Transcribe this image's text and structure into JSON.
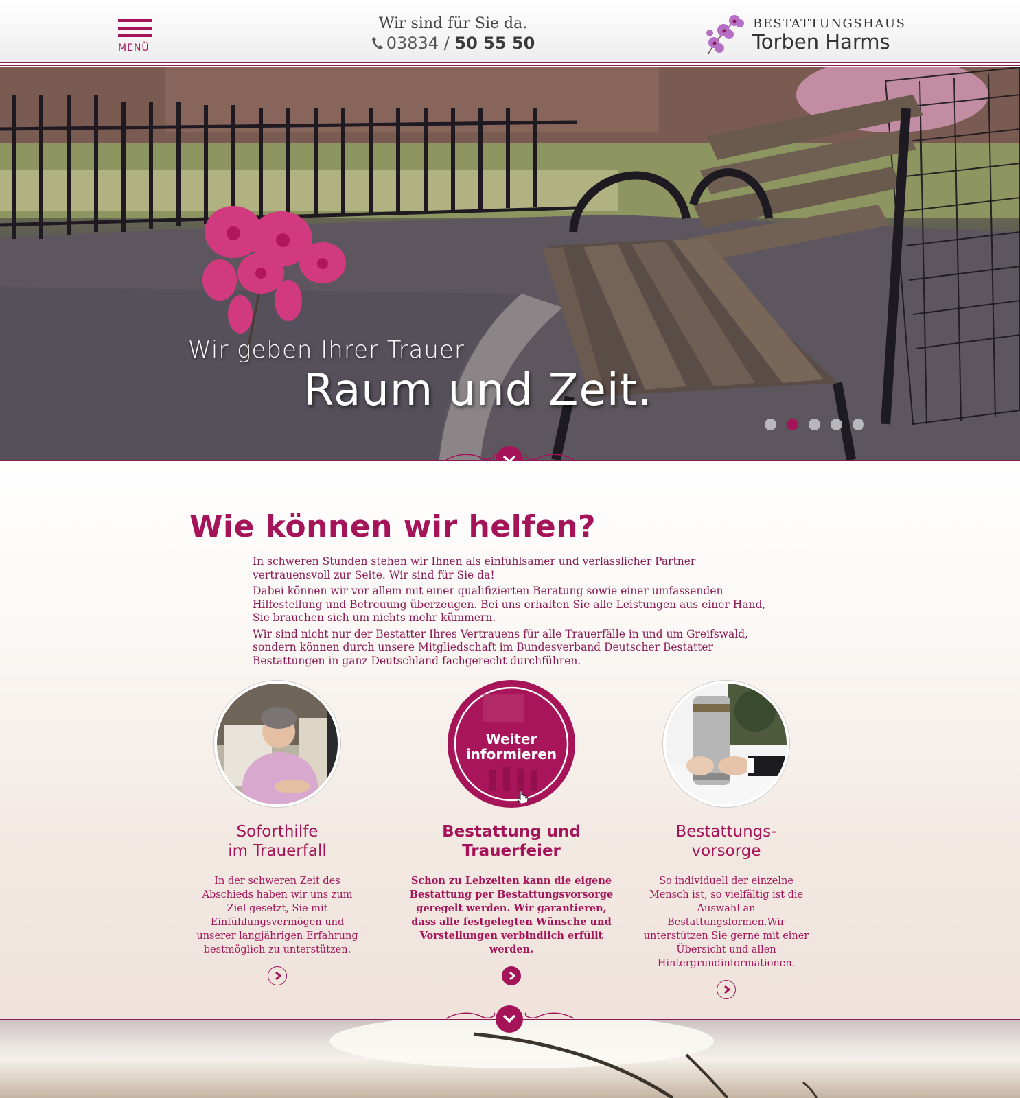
{
  "header": {
    "menu_label": "MENÜ",
    "tagline": "Wir sind für Sie da.",
    "phone_prefix": "03834 / ",
    "phone_main": "50 55 50",
    "logo_line1": "BESTATTUNGSHAUS",
    "logo_line2": "Torben Harms"
  },
  "hero": {
    "title_line1": "Wir geben Ihrer Trauer",
    "title_line2": "Raum und Zeit.",
    "slides": 5,
    "active_slide": 2
  },
  "main": {
    "heading": "Wie können wir helfen?",
    "paragraphs": [
      "In schweren Stunden stehen wir Ihnen als einfühlsamer und verlässlicher Partner vertrauensvoll zur Seite. Wir sind für Sie da!",
      "Dabei können wir vor allem mit einer qualifizierten Beratung sowie einer umfassenden Hilfestellung und Betreuung überzeugen. Bei uns erhalten Sie alle Leistungen aus einer Hand, Sie brauchen sich um nichts mehr kümmern.",
      "Wir sind nicht nur der Bestatter Ihres Vertrauens für alle Trauerfälle in und um Greifswald, sondern können durch unsere Mitgliedschaft im Bundesverband Deutscher Bestatter Bestattungen in ganz Deutschland fachgerecht durchführen."
    ],
    "cards": [
      {
        "title_line1": "Soforthilfe",
        "title_line2": "im Trauerfall",
        "text": "In der schweren Zeit des Abschieds haben wir uns zum Ziel gesetzt, Sie mit Einfühlungsvermögen und unserer langjährigen Erfahrung bestmöglich zu unterstützen."
      },
      {
        "title_line1": "Bestattung und",
        "title_line2": "Trauerfeier",
        "overlay_line1": "Weiter",
        "overlay_line2": "informieren",
        "text": "Schon zu Lebzeiten kann die eigene Bestattung per Bestattungsvorsorge geregelt werden. Wir garantieren, dass alle festgelegten Wünsche und Vorstellungen verbindlich erfüllt werden."
      },
      {
        "title_line1": "Bestattungs-",
        "title_line2": "vorsorge",
        "text": "So individuell der einzelne Mensch ist, so vielfältig ist die Auswahl an Bestattungsformen.Wir unterstützen Sie gerne mit einer Übersicht und allen Hintergrundinformationen."
      }
    ]
  },
  "colors": {
    "accent": "#a51458",
    "accent_dark": "#8b1a52",
    "text_dark": "#333333"
  },
  "icons": [
    "menu-icon",
    "phone-icon",
    "orchid-logo-icon",
    "chevron-down-icon",
    "chevron-right-icon",
    "hand-cursor-icon"
  ]
}
